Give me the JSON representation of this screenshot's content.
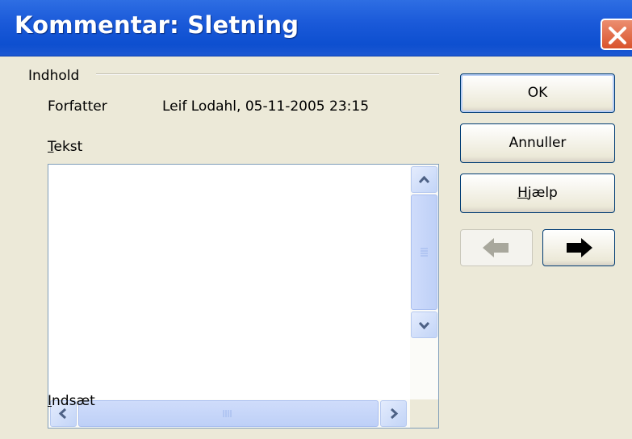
{
  "window": {
    "title": "Kommentar: Sletning"
  },
  "content": {
    "group_label": "Indhold",
    "author_label": "Forfatter",
    "author_value": "Leif Lodahl, 05-11-2005 23:15",
    "text_label_first": "T",
    "text_label_rest": "ekst",
    "text_value": "",
    "insert_label_first": "I",
    "insert_label_rest": "ndsæt"
  },
  "buttons": {
    "ok": "OK",
    "cancel": "Annuller",
    "help_first": "H",
    "help_rest": "jælp"
  },
  "icons": {
    "close": "close-icon",
    "prev": "arrow-left-icon",
    "next": "arrow-right-icon"
  }
}
